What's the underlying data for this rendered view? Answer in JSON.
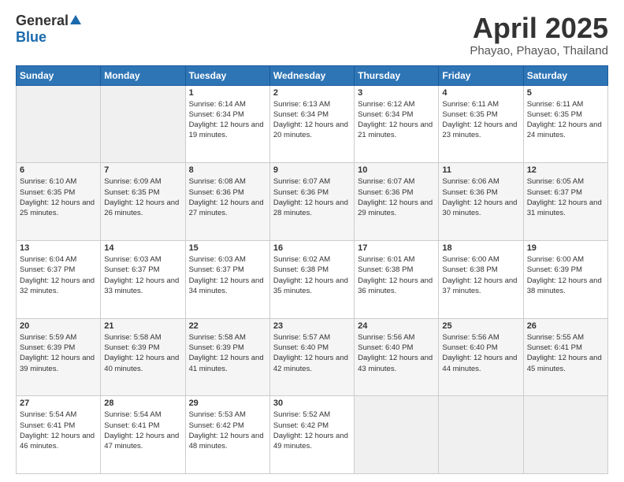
{
  "header": {
    "logo_general": "General",
    "logo_blue": "Blue",
    "title": "April 2025",
    "location": "Phayao, Phayao, Thailand"
  },
  "days_of_week": [
    "Sunday",
    "Monday",
    "Tuesday",
    "Wednesday",
    "Thursday",
    "Friday",
    "Saturday"
  ],
  "weeks": [
    [
      {
        "day": "",
        "sunrise": "",
        "sunset": "",
        "daylight": ""
      },
      {
        "day": "",
        "sunrise": "",
        "sunset": "",
        "daylight": ""
      },
      {
        "day": "1",
        "sunrise": "Sunrise: 6:14 AM",
        "sunset": "Sunset: 6:34 PM",
        "daylight": "Daylight: 12 hours and 19 minutes."
      },
      {
        "day": "2",
        "sunrise": "Sunrise: 6:13 AM",
        "sunset": "Sunset: 6:34 PM",
        "daylight": "Daylight: 12 hours and 20 minutes."
      },
      {
        "day": "3",
        "sunrise": "Sunrise: 6:12 AM",
        "sunset": "Sunset: 6:34 PM",
        "daylight": "Daylight: 12 hours and 21 minutes."
      },
      {
        "day": "4",
        "sunrise": "Sunrise: 6:11 AM",
        "sunset": "Sunset: 6:35 PM",
        "daylight": "Daylight: 12 hours and 23 minutes."
      },
      {
        "day": "5",
        "sunrise": "Sunrise: 6:11 AM",
        "sunset": "Sunset: 6:35 PM",
        "daylight": "Daylight: 12 hours and 24 minutes."
      }
    ],
    [
      {
        "day": "6",
        "sunrise": "Sunrise: 6:10 AM",
        "sunset": "Sunset: 6:35 PM",
        "daylight": "Daylight: 12 hours and 25 minutes."
      },
      {
        "day": "7",
        "sunrise": "Sunrise: 6:09 AM",
        "sunset": "Sunset: 6:35 PM",
        "daylight": "Daylight: 12 hours and 26 minutes."
      },
      {
        "day": "8",
        "sunrise": "Sunrise: 6:08 AM",
        "sunset": "Sunset: 6:36 PM",
        "daylight": "Daylight: 12 hours and 27 minutes."
      },
      {
        "day": "9",
        "sunrise": "Sunrise: 6:07 AM",
        "sunset": "Sunset: 6:36 PM",
        "daylight": "Daylight: 12 hours and 28 minutes."
      },
      {
        "day": "10",
        "sunrise": "Sunrise: 6:07 AM",
        "sunset": "Sunset: 6:36 PM",
        "daylight": "Daylight: 12 hours and 29 minutes."
      },
      {
        "day": "11",
        "sunrise": "Sunrise: 6:06 AM",
        "sunset": "Sunset: 6:36 PM",
        "daylight": "Daylight: 12 hours and 30 minutes."
      },
      {
        "day": "12",
        "sunrise": "Sunrise: 6:05 AM",
        "sunset": "Sunset: 6:37 PM",
        "daylight": "Daylight: 12 hours and 31 minutes."
      }
    ],
    [
      {
        "day": "13",
        "sunrise": "Sunrise: 6:04 AM",
        "sunset": "Sunset: 6:37 PM",
        "daylight": "Daylight: 12 hours and 32 minutes."
      },
      {
        "day": "14",
        "sunrise": "Sunrise: 6:03 AM",
        "sunset": "Sunset: 6:37 PM",
        "daylight": "Daylight: 12 hours and 33 minutes."
      },
      {
        "day": "15",
        "sunrise": "Sunrise: 6:03 AM",
        "sunset": "Sunset: 6:37 PM",
        "daylight": "Daylight: 12 hours and 34 minutes."
      },
      {
        "day": "16",
        "sunrise": "Sunrise: 6:02 AM",
        "sunset": "Sunset: 6:38 PM",
        "daylight": "Daylight: 12 hours and 35 minutes."
      },
      {
        "day": "17",
        "sunrise": "Sunrise: 6:01 AM",
        "sunset": "Sunset: 6:38 PM",
        "daylight": "Daylight: 12 hours and 36 minutes."
      },
      {
        "day": "18",
        "sunrise": "Sunrise: 6:00 AM",
        "sunset": "Sunset: 6:38 PM",
        "daylight": "Daylight: 12 hours and 37 minutes."
      },
      {
        "day": "19",
        "sunrise": "Sunrise: 6:00 AM",
        "sunset": "Sunset: 6:39 PM",
        "daylight": "Daylight: 12 hours and 38 minutes."
      }
    ],
    [
      {
        "day": "20",
        "sunrise": "Sunrise: 5:59 AM",
        "sunset": "Sunset: 6:39 PM",
        "daylight": "Daylight: 12 hours and 39 minutes."
      },
      {
        "day": "21",
        "sunrise": "Sunrise: 5:58 AM",
        "sunset": "Sunset: 6:39 PM",
        "daylight": "Daylight: 12 hours and 40 minutes."
      },
      {
        "day": "22",
        "sunrise": "Sunrise: 5:58 AM",
        "sunset": "Sunset: 6:39 PM",
        "daylight": "Daylight: 12 hours and 41 minutes."
      },
      {
        "day": "23",
        "sunrise": "Sunrise: 5:57 AM",
        "sunset": "Sunset: 6:40 PM",
        "daylight": "Daylight: 12 hours and 42 minutes."
      },
      {
        "day": "24",
        "sunrise": "Sunrise: 5:56 AM",
        "sunset": "Sunset: 6:40 PM",
        "daylight": "Daylight: 12 hours and 43 minutes."
      },
      {
        "day": "25",
        "sunrise": "Sunrise: 5:56 AM",
        "sunset": "Sunset: 6:40 PM",
        "daylight": "Daylight: 12 hours and 44 minutes."
      },
      {
        "day": "26",
        "sunrise": "Sunrise: 5:55 AM",
        "sunset": "Sunset: 6:41 PM",
        "daylight": "Daylight: 12 hours and 45 minutes."
      }
    ],
    [
      {
        "day": "27",
        "sunrise": "Sunrise: 5:54 AM",
        "sunset": "Sunset: 6:41 PM",
        "daylight": "Daylight: 12 hours and 46 minutes."
      },
      {
        "day": "28",
        "sunrise": "Sunrise: 5:54 AM",
        "sunset": "Sunset: 6:41 PM",
        "daylight": "Daylight: 12 hours and 47 minutes."
      },
      {
        "day": "29",
        "sunrise": "Sunrise: 5:53 AM",
        "sunset": "Sunset: 6:42 PM",
        "daylight": "Daylight: 12 hours and 48 minutes."
      },
      {
        "day": "30",
        "sunrise": "Sunrise: 5:52 AM",
        "sunset": "Sunset: 6:42 PM",
        "daylight": "Daylight: 12 hours and 49 minutes."
      },
      {
        "day": "",
        "sunrise": "",
        "sunset": "",
        "daylight": ""
      },
      {
        "day": "",
        "sunrise": "",
        "sunset": "",
        "daylight": ""
      },
      {
        "day": "",
        "sunrise": "",
        "sunset": "",
        "daylight": ""
      }
    ]
  ]
}
